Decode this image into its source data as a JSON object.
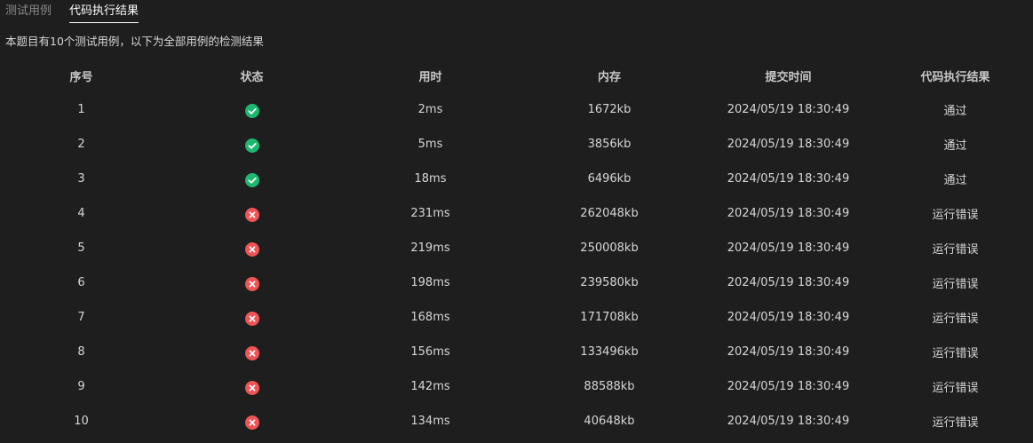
{
  "tabs": [
    {
      "label": "测试用例",
      "active": false
    },
    {
      "label": "代码执行结果",
      "active": true
    }
  ],
  "summary": "本题目有10个测试用例，以下为全部用例的检测结果",
  "table": {
    "headers": [
      "序号",
      "状态",
      "用时",
      "内存",
      "提交时间",
      "代码执行结果"
    ],
    "rows": [
      {
        "index": "1",
        "status": "pass",
        "time": "2ms",
        "memory": "1672kb",
        "submitted": "2024/05/19 18:30:49",
        "result": "通过"
      },
      {
        "index": "2",
        "status": "pass",
        "time": "5ms",
        "memory": "3856kb",
        "submitted": "2024/05/19 18:30:49",
        "result": "通过"
      },
      {
        "index": "3",
        "status": "pass",
        "time": "18ms",
        "memory": "6496kb",
        "submitted": "2024/05/19 18:30:49",
        "result": "通过"
      },
      {
        "index": "4",
        "status": "fail",
        "time": "231ms",
        "memory": "262048kb",
        "submitted": "2024/05/19 18:30:49",
        "result": "运行错误"
      },
      {
        "index": "5",
        "status": "fail",
        "time": "219ms",
        "memory": "250008kb",
        "submitted": "2024/05/19 18:30:49",
        "result": "运行错误"
      },
      {
        "index": "6",
        "status": "fail",
        "time": "198ms",
        "memory": "239580kb",
        "submitted": "2024/05/19 18:30:49",
        "result": "运行错误"
      },
      {
        "index": "7",
        "status": "fail",
        "time": "168ms",
        "memory": "171708kb",
        "submitted": "2024/05/19 18:30:49",
        "result": "运行错误"
      },
      {
        "index": "8",
        "status": "fail",
        "time": "156ms",
        "memory": "133496kb",
        "submitted": "2024/05/19 18:30:49",
        "result": "运行错误"
      },
      {
        "index": "9",
        "status": "fail",
        "time": "142ms",
        "memory": "88588kb",
        "submitted": "2024/05/19 18:30:49",
        "result": "运行错误"
      },
      {
        "index": "10",
        "status": "fail",
        "time": "134ms",
        "memory": "40648kb",
        "submitted": "2024/05/19 18:30:49",
        "result": "运行错误"
      }
    ]
  },
  "icons": {
    "pass": "check-circle-icon",
    "fail": "x-circle-icon"
  },
  "colors": {
    "background": "#1e1e1e",
    "pass": "#1db86f",
    "fail": "#f05454",
    "active_tab": "#ffffff",
    "inactive_tab": "#8a8a8a"
  }
}
